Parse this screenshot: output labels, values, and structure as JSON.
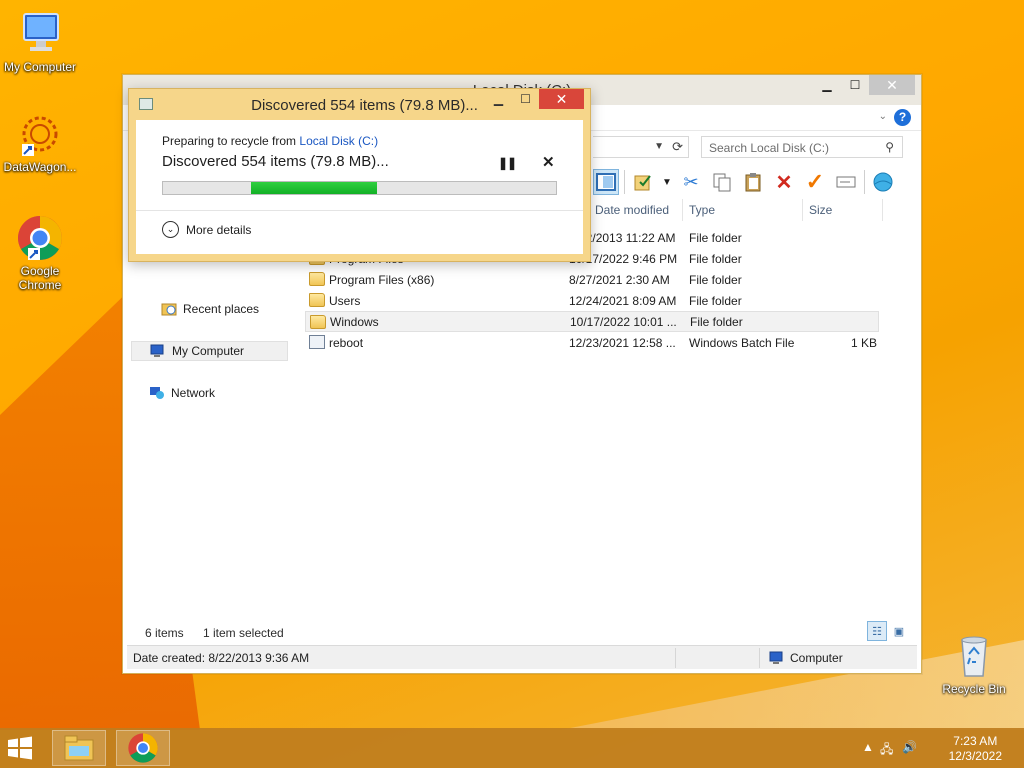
{
  "desktop": {
    "icons": [
      {
        "label": "My Computer"
      },
      {
        "label": "DataWagon..."
      },
      {
        "label": "Google Chrome"
      },
      {
        "label": "Recycle Bin"
      }
    ]
  },
  "explorer": {
    "title": "Local Disk (C:)",
    "search_placeholder": "Search Local Disk (C:)",
    "columns": [
      "Date modified",
      "Type",
      "Size"
    ],
    "nav": [
      {
        "label": "Recent places"
      },
      {
        "label": "My Computer"
      },
      {
        "label": "Network"
      }
    ],
    "files": [
      {
        "name": "",
        "date": "8/22/2013 11:22 AM",
        "type": "File folder",
        "size": ""
      },
      {
        "name": "Program Files",
        "date": "10/17/2022 9:46 PM",
        "type": "File folder",
        "size": ""
      },
      {
        "name": "Program Files (x86)",
        "date": "8/27/2021 2:30 AM",
        "type": "File folder",
        "size": ""
      },
      {
        "name": "Users",
        "date": "12/24/2021 8:09 AM",
        "type": "File folder",
        "size": ""
      },
      {
        "name": "Windows",
        "date": "10/17/2022 10:01 ...",
        "type": "File folder",
        "size": ""
      },
      {
        "name": "reboot",
        "date": "12/23/2021 12:58 ...",
        "type": "Windows Batch File",
        "size": "1 KB"
      }
    ],
    "status": {
      "items": "6 items",
      "selected": "1 item selected"
    },
    "details": {
      "date_created": "Date created: 8/22/2013 9:36 AM",
      "location": "Computer"
    }
  },
  "dialog": {
    "title": "Discovered 554 items (79.8 MB)...",
    "subtitle_prefix": "Preparing to recycle from ",
    "subtitle_link": "Local Disk (C:)",
    "main_text": "Discovered 554 items (79.8 MB)...",
    "more_details": "More details",
    "progress": {
      "start_fraction": 0.225,
      "end_fraction": 0.545
    }
  },
  "taskbar": {
    "time": "7:23 AM",
    "date": "12/3/2022"
  },
  "colors": {
    "accent": "#1e6fd9",
    "progress_green": "#12b026",
    "dialog_close": "#d9463a",
    "dialog_frame": "#f6d68a"
  }
}
